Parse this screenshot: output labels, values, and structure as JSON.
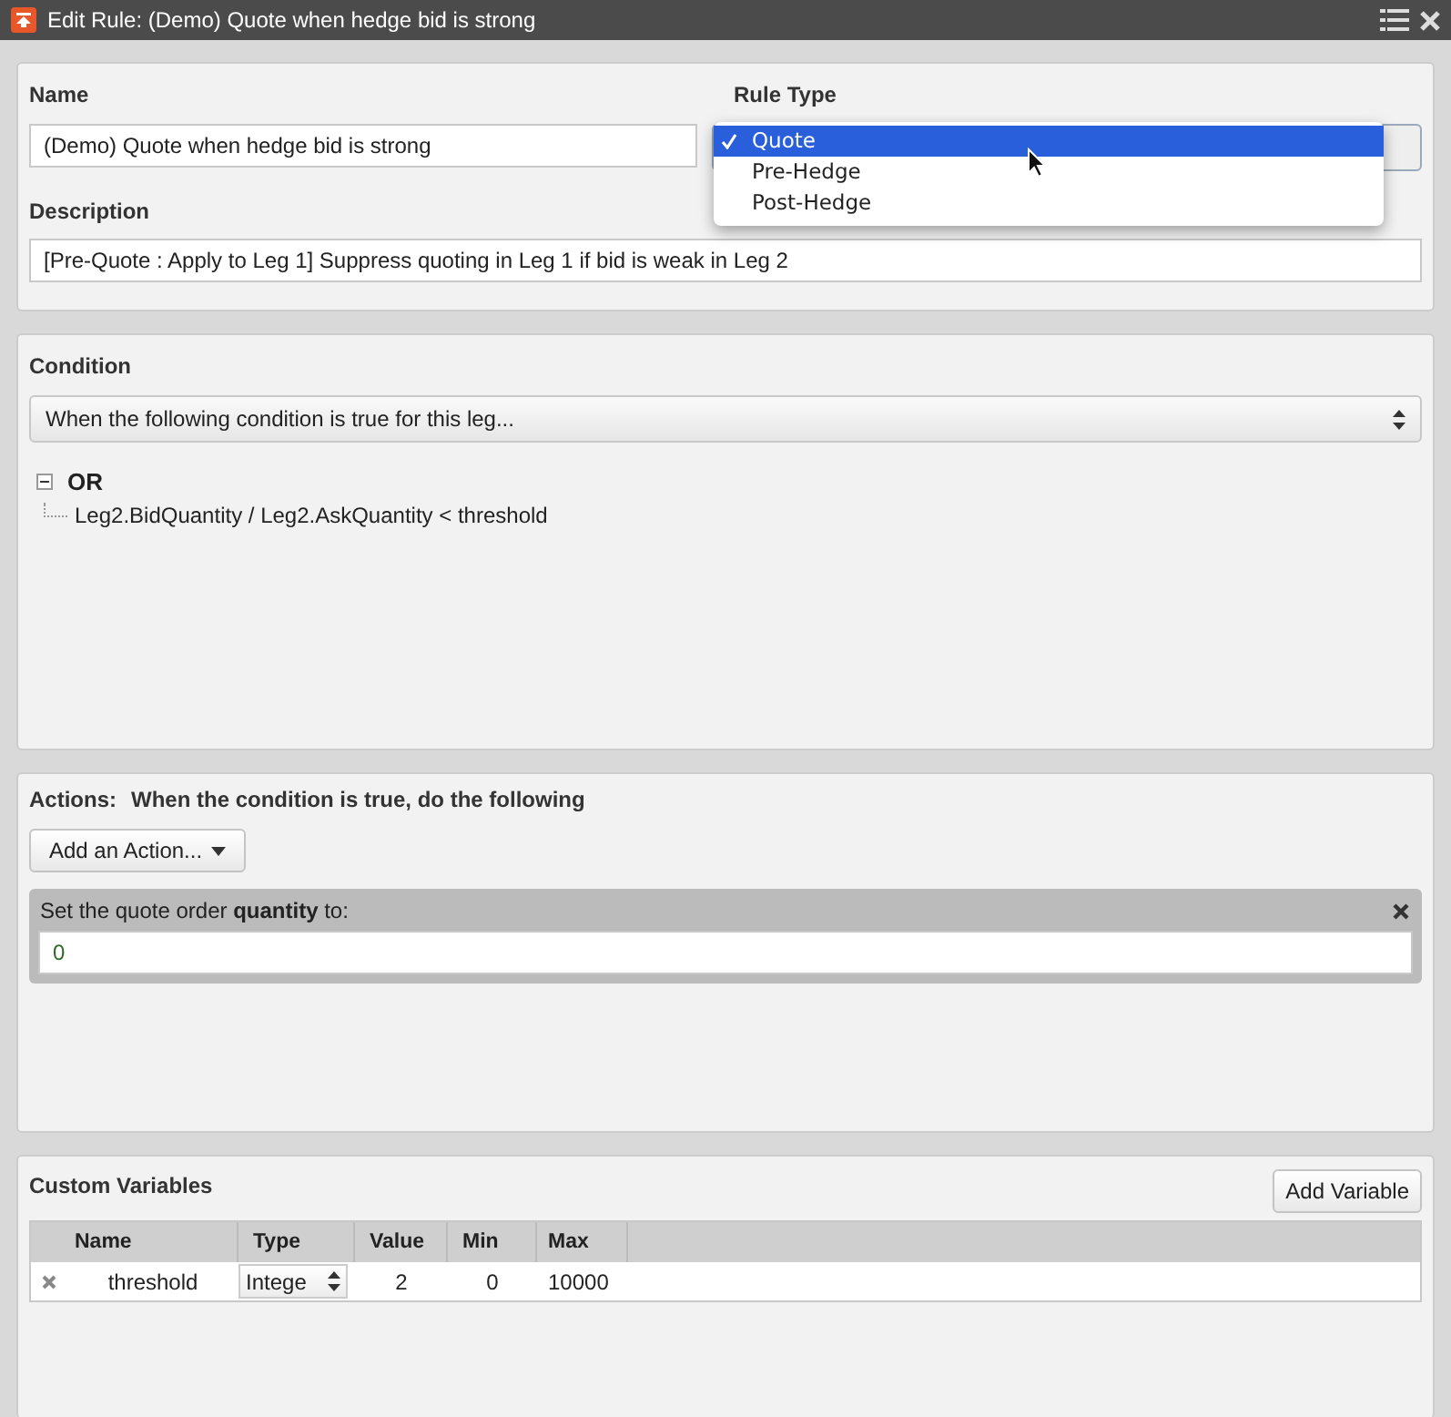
{
  "window": {
    "title": "Edit Rule: (Demo) Quote when hedge bid is strong"
  },
  "rule": {
    "name_label": "Name",
    "name_value": "(Demo) Quote when hedge bid is strong",
    "rule_type_label": "Rule Type",
    "rule_type_options": [
      {
        "label": "Quote",
        "selected": true
      },
      {
        "label": "Pre-Hedge",
        "selected": false
      },
      {
        "label": "Post-Hedge",
        "selected": false
      }
    ],
    "description_label": "Description",
    "description_value": "[Pre-Quote : Apply to Leg 1] Suppress quoting in Leg 1 if bid is weak in Leg 2"
  },
  "condition": {
    "title": "Condition",
    "select_value": "When the following condition is true for this leg...",
    "tree": [
      {
        "label": "OR",
        "expanded": true,
        "children": [
          {
            "label": "Leg2.BidQuantity / Leg2.AskQuantity < threshold"
          }
        ]
      }
    ]
  },
  "actions": {
    "title": "Actions:",
    "subtitle": "When the condition is true, do the following",
    "add_button": "Add an Action...",
    "items": [
      {
        "text": "Set the quote order **quantity** to:",
        "value": "0"
      }
    ]
  },
  "custom_variables": {
    "title": "Custom Variables",
    "add_button": "Add Variable",
    "columns": [
      "Name",
      "Type",
      "Value",
      "Min",
      "Max"
    ],
    "rows": [
      {
        "name": "threshold",
        "type": "Intege",
        "value": "2",
        "min": "0",
        "max": "10000"
      }
    ]
  }
}
